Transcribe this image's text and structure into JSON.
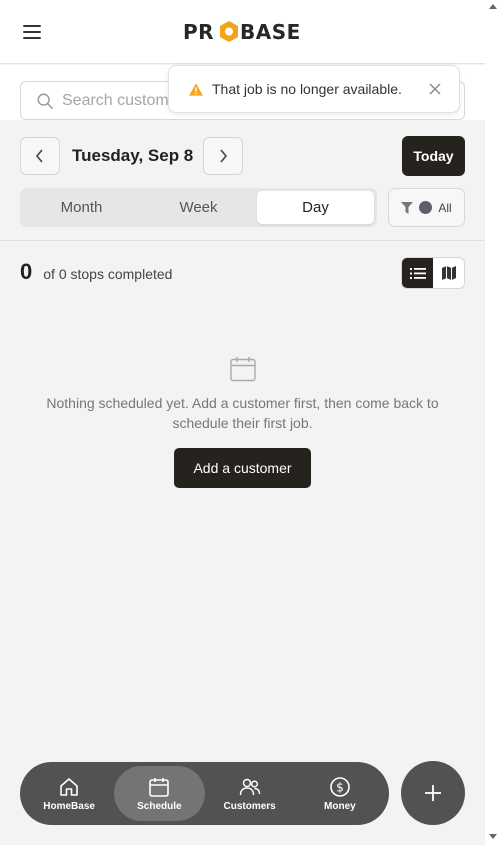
{
  "app": {
    "brand": "PROBASE"
  },
  "search": {
    "placeholder": "Search customers"
  },
  "toast": {
    "message": "That job is no longer available.",
    "close_icon": "close-icon",
    "status_icon": "warning-icon",
    "warning_color": "#f5a623"
  },
  "schedule": {
    "date_label": "Tuesday, Sep 8",
    "today_label": "Today",
    "tabs": [
      {
        "label": "Month",
        "active": false
      },
      {
        "label": "Week",
        "active": false
      },
      {
        "label": "Day",
        "active": true
      }
    ],
    "filter_label": "All",
    "stops_count": "0",
    "stops_text": "of 0 stops completed",
    "view_mode": "list"
  },
  "empty_state": {
    "message": "Nothing scheduled yet. Add a customer first, then come back to schedule their first job.",
    "button_label": "Add a customer"
  },
  "bottom_nav": {
    "items": [
      {
        "label": "HomeBase",
        "icon": "home-icon",
        "active": false
      },
      {
        "label": "Schedule",
        "icon": "calendar-icon",
        "active": true
      },
      {
        "label": "Customers",
        "icon": "users-icon",
        "active": false
      },
      {
        "label": "Money",
        "icon": "dollar-icon",
        "active": false
      }
    ],
    "fab_icon": "plus-icon"
  },
  "colors": {
    "primary_dark": "#26231f",
    "nav_bg": "#525252",
    "nav_active": "#747474",
    "logo_accent": "#f2a51a"
  }
}
